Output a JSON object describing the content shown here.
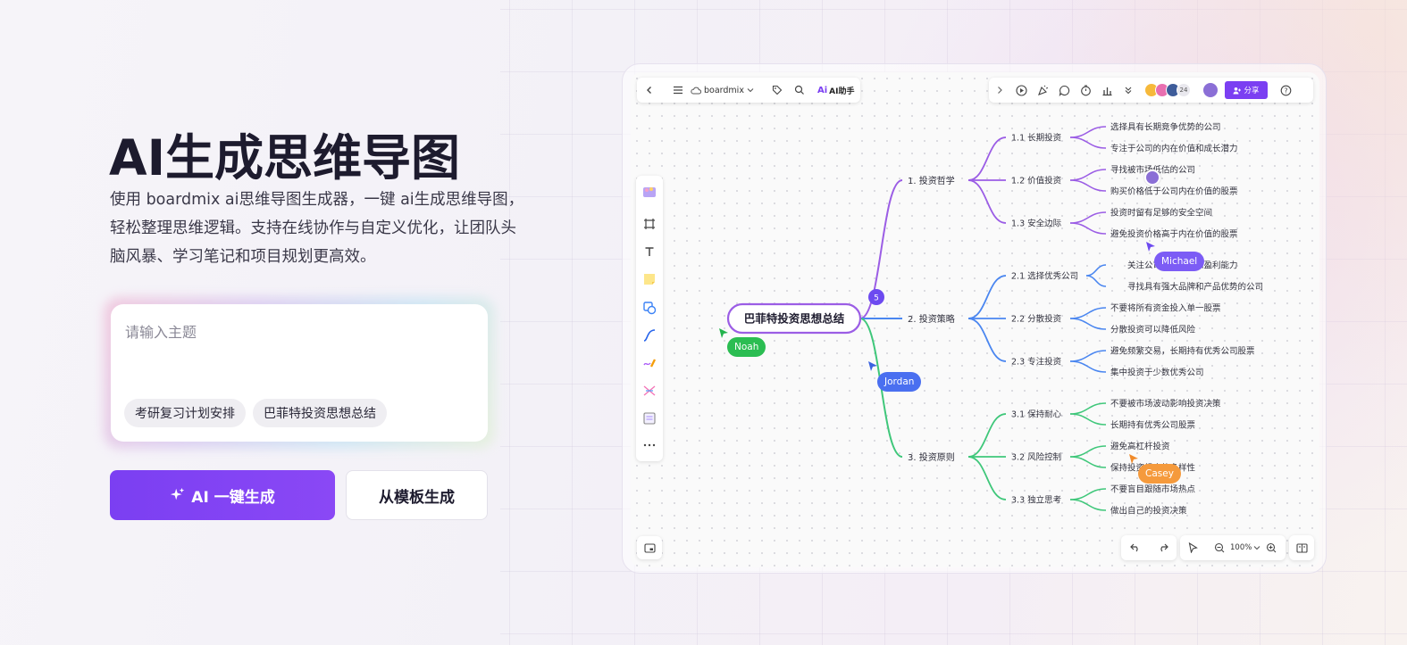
{
  "hero": {
    "title": "AI生成思维导图",
    "description": "使用 boardmix ai思维导图生成器，一键 ai生成思维导图，轻松整理思维逻辑。支持在线协作与自定义优化，让团队头脑风暴、学习笔记和项目规划更高效。"
  },
  "input": {
    "placeholder": "请输入主题",
    "chips": [
      "考研复习计划安排",
      "巴菲特投资思想总结"
    ]
  },
  "buttons": {
    "ai_generate": "AI 一键生成",
    "template_generate": "从模板生成"
  },
  "app": {
    "workspace_name": "boardmix",
    "ai_assistant": "AI助手",
    "collaborator_count": "24",
    "share_label": "分享",
    "zoom": "100%",
    "colors": {
      "branch1": "#9b5de5",
      "branch2": "#4a86f0",
      "branch3": "#3fc77a",
      "accent": "#7b3ff2"
    }
  },
  "mindmap": {
    "root": "巴菲特投资思想总结",
    "badge": "5",
    "branches": [
      {
        "label": "1. 投资哲学",
        "children": [
          {
            "label": "1.1 长期投资",
            "leaves": [
              "选择具有长期竞争优势的公司",
              "专注于公司的内在价值和成长潜力"
            ]
          },
          {
            "label": "1.2 价值投资",
            "leaves": [
              "寻找被市场低估的公司",
              "购买价格低于公司内在价值的股票"
            ]
          },
          {
            "label": "1.3 安全边际",
            "leaves": [
              "投资时留有足够的安全空间",
              "避免投资价格高于内在价值的股票"
            ]
          }
        ]
      },
      {
        "label": "2. 投资策略",
        "children": [
          {
            "label": "2.1 选择优秀公司",
            "leaves": [
              "关注公司的管理层和盈利能力",
              "寻找具有强大品牌和产品优势的公司"
            ]
          },
          {
            "label": "2.2 分散投资",
            "leaves": [
              "不要将所有资金投入单一股票",
              "分散投资可以降低风险"
            ]
          },
          {
            "label": "2.3 专注投资",
            "leaves": [
              "避免频繁交易，长期持有优秀公司股票",
              "集中投资于少数优秀公司"
            ]
          }
        ]
      },
      {
        "label": "3. 投资原则",
        "children": [
          {
            "label": "3.1 保持耐心",
            "leaves": [
              "不要被市场波动影响投资决策",
              "长期持有优秀公司股票"
            ]
          },
          {
            "label": "3.2 风险控制",
            "leaves": [
              "避免高杠杆投资",
              "保持投资组合的多样性"
            ]
          },
          {
            "label": "3.3 独立思考",
            "leaves": [
              "不要盲目跟随市场热点",
              "做出自己的投资决策"
            ]
          }
        ]
      }
    ]
  },
  "cursors": [
    "Michael",
    "Noah",
    "Jordan",
    "Casey"
  ]
}
